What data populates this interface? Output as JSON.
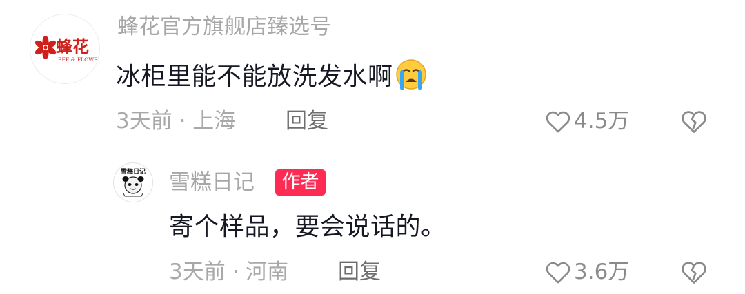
{
  "comment": {
    "username": "蜂花官方旗舰店臻选号",
    "avatar_brand": "蜂花",
    "avatar_brand_en": "BEE & FLOWER",
    "text": "冰柜里能不能放洗发水啊",
    "emoji": "crying-face",
    "meta": "3天前 · 上海",
    "reply_label": "回复",
    "like_count": "4.5万"
  },
  "reply": {
    "username": "雪糕日记",
    "avatar_label": "雪糕日记",
    "author_badge": "作者",
    "text": "寄个样品，要会说话的。",
    "meta": "3天前 · 河南",
    "reply_label": "回复",
    "like_count": "3.6万"
  },
  "colors": {
    "brand_red": "#d0201b",
    "badge_red": "#fe2c55",
    "text_primary": "#161823",
    "text_secondary": "#a8a8a8"
  }
}
